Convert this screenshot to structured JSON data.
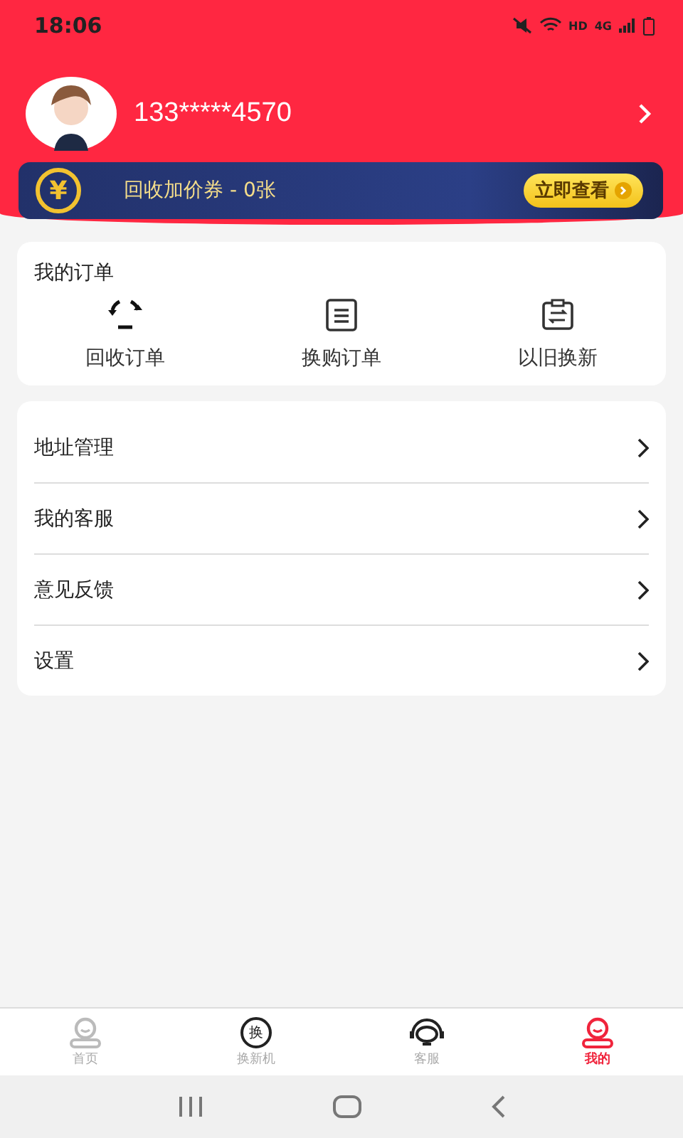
{
  "status_bar": {
    "time": "18:06",
    "network_label": "HD",
    "network_type": "4G"
  },
  "profile": {
    "phone": "133*****4570"
  },
  "coupon_banner": {
    "text": "回收加价券 - 0张",
    "button": "立即查看",
    "currency": "¥"
  },
  "orders": {
    "title": "我的订单",
    "items": [
      {
        "label": "回收订单"
      },
      {
        "label": "换购订单"
      },
      {
        "label": "以旧换新"
      }
    ]
  },
  "menu": [
    {
      "label": "地址管理"
    },
    {
      "label": "我的客服"
    },
    {
      "label": "意见反馈"
    },
    {
      "label": "设置"
    }
  ],
  "tab_bar": [
    {
      "label": "首页",
      "selected": false
    },
    {
      "label": "换新机",
      "selected": false,
      "icon_char": "换"
    },
    {
      "label": "客服",
      "selected": false
    },
    {
      "label": "我的",
      "selected": true
    }
  ]
}
